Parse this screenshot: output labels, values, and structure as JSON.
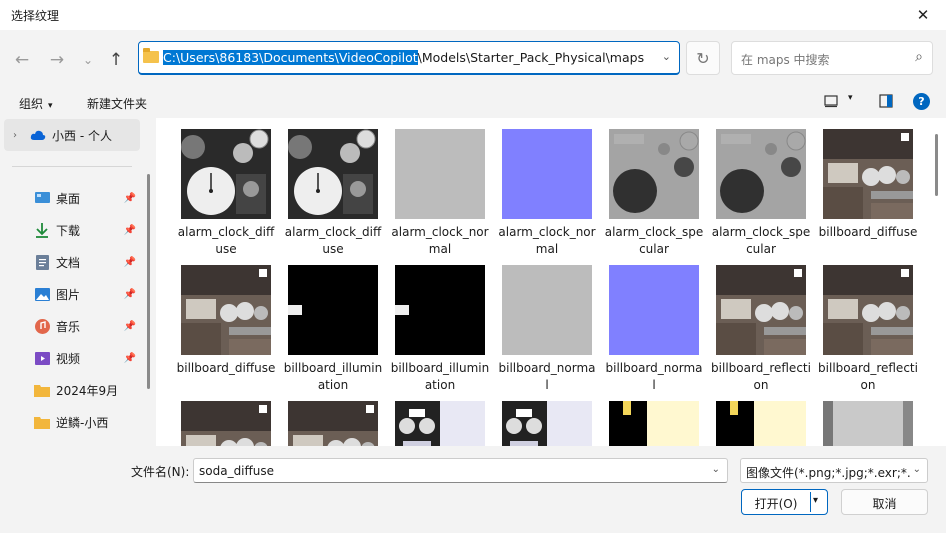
{
  "window": {
    "title": "选择纹理",
    "close_glyph": "✕"
  },
  "nav": {
    "back_glyph": "←",
    "forward_glyph": "→",
    "recent_glyph": "⌄",
    "up_glyph": "↑",
    "address_selected": "C:\\Users\\86183\\Documents\\VideoCopilot",
    "address_rest": "\\Models\\Starter_Pack_Physical\\maps",
    "address_dropdown_glyph": "⌄",
    "refresh_glyph": "↻",
    "search_placeholder": "在 maps 中搜索",
    "search_glyph": "⌕"
  },
  "commands": {
    "organize": "组织",
    "new_folder": "新建文件夹",
    "caret": "▾",
    "help": "?"
  },
  "sidebar": {
    "items": [
      {
        "label": "小西 - 个人",
        "icon": "onedrive-cloud-icon",
        "chevron": "›",
        "selected": true
      },
      {
        "label": "桌面",
        "icon": "desktop-icon",
        "pinned": true
      },
      {
        "label": "下载",
        "icon": "download-icon",
        "pinned": true
      },
      {
        "label": "文档",
        "icon": "document-icon",
        "pinned": true
      },
      {
        "label": "图片",
        "icon": "pictures-icon",
        "pinned": true
      },
      {
        "label": "音乐",
        "icon": "music-icon",
        "pinned": true
      },
      {
        "label": "视频",
        "icon": "video-icon",
        "pinned": true
      },
      {
        "label": "2024年9月",
        "icon": "folder-icon",
        "pinned": false
      },
      {
        "label": "逆鳞-小西",
        "icon": "folder-icon",
        "pinned": false
      }
    ],
    "pin_glyph": "📌"
  },
  "files": [
    {
      "name": "alarm_clock_diffuse",
      "thumb": "clock-dark"
    },
    {
      "name": "alarm_clock_diffuse",
      "thumb": "clock-dark"
    },
    {
      "name": "alarm_clock_normal",
      "thumb": "gray"
    },
    {
      "name": "alarm_clock_normal",
      "thumb": "normal-blue"
    },
    {
      "name": "alarm_clock_specular",
      "thumb": "clock-spec"
    },
    {
      "name": "alarm_clock_specular",
      "thumb": "clock-spec"
    },
    {
      "name": "billboard_diffuse",
      "thumb": "billboard"
    },
    {
      "name": "billboard_diffuse",
      "thumb": "billboard"
    },
    {
      "name": "billboard_illumination",
      "thumb": "illum"
    },
    {
      "name": "billboard_illumination",
      "thumb": "illum"
    },
    {
      "name": "billboard_normal",
      "thumb": "gray"
    },
    {
      "name": "billboard_normal",
      "thumb": "normal-blue"
    },
    {
      "name": "billboard_reflection",
      "thumb": "billboard"
    },
    {
      "name": "billboard_reflection",
      "thumb": "billboard"
    },
    {
      "name": "",
      "thumb": "billboard"
    },
    {
      "name": "",
      "thumb": "billboard"
    },
    {
      "name": "",
      "thumb": "robot"
    },
    {
      "name": "",
      "thumb": "robot"
    },
    {
      "name": "",
      "thumb": "soda-yellow"
    },
    {
      "name": "",
      "thumb": "soda-yellow"
    },
    {
      "name": "",
      "thumb": "soda-gray"
    }
  ],
  "footer": {
    "filename_label": "文件名(N):",
    "filename_value": "soda_diffuse",
    "filetype_value": "图像文件(*.png;*.jpg;*.exr;*.hdr)",
    "open_label": "打开(O)",
    "cancel_label": "取消",
    "dropdown_glyph": "⌄"
  }
}
